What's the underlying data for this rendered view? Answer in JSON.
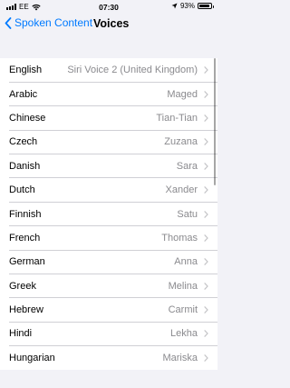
{
  "status_bar": {
    "carrier": "EE",
    "time": "07:30",
    "battery_percent": "93%",
    "battery_level": 0.93,
    "icons": [
      "wifi-icon",
      "location-icon",
      "battery-icon",
      "signal-icon"
    ]
  },
  "nav": {
    "back_label": "Spoken Content",
    "title": "Voices",
    "accent_color": "#007aff"
  },
  "voices": [
    {
      "language": "English",
      "voice": "Siri Voice 2 (United Kingdom)"
    },
    {
      "language": "Arabic",
      "voice": "Maged"
    },
    {
      "language": "Chinese",
      "voice": "Tian-Tian"
    },
    {
      "language": "Czech",
      "voice": "Zuzana"
    },
    {
      "language": "Danish",
      "voice": "Sara"
    },
    {
      "language": "Dutch",
      "voice": "Xander"
    },
    {
      "language": "Finnish",
      "voice": "Satu"
    },
    {
      "language": "French",
      "voice": "Thomas"
    },
    {
      "language": "German",
      "voice": "Anna"
    },
    {
      "language": "Greek",
      "voice": "Melina"
    },
    {
      "language": "Hebrew",
      "voice": "Carmit"
    },
    {
      "language": "Hindi",
      "voice": "Lekha"
    },
    {
      "language": "Hungarian",
      "voice": "Mariska"
    }
  ]
}
